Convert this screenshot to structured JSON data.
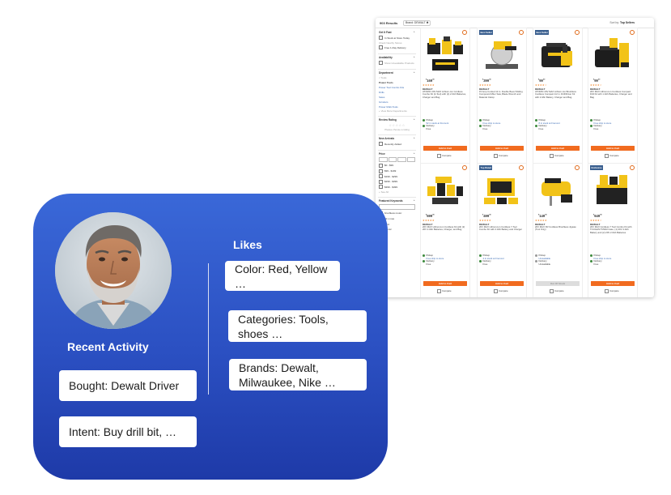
{
  "shop": {
    "results_count": "903 Results",
    "filter_chip": "Brand: DEWALT ✖",
    "sort_label": "Sort by:",
    "sort_value": "Top Sellers",
    "sidebar": {
      "get_it_fast": "Get It Fast",
      "in_stock": "In Stock at Store Today",
      "pickup_note": "Check Nearby Stores",
      "free_delivery": "Free 1-Day Delivery",
      "availability": "Availability",
      "include_out": "Show Unavailable Products",
      "department": "Department",
      "tools": "< Tools",
      "power_tools": "Power Tools",
      "power_tool_combo": "Power Tool Combo Kits",
      "drills": "Drills",
      "saws": "Saws",
      "grinders": "Grinders",
      "power_multi": "Power Multi-Tools",
      "view_more": "+ View More Departments",
      "review_rating": "Review Rating",
      "stars": "☆☆☆☆☆",
      "choose_rating": "Please choose a rating",
      "new_arrivals": "New Arrivals",
      "recently_added": "Recently Added",
      "price": "Price",
      "price_ranges": [
        "$0 - $99",
        "$99 - $199",
        "$199 - $299",
        "$299 - $399",
        "$399 - $499"
      ],
      "see_all": "+ See All",
      "featured_keywords": "Featured Keywords",
      "keywords": [
        "brushless motor",
        "20 v max",
        "cord",
        "atomic"
      ]
    },
    "cards": [
      {
        "badge": "",
        "price": "169",
        "cents": "00",
        "stars": "★★★★★",
        "brand": "DEWALT",
        "desc": "ATOMIC 20V MAX Lithium-Ion Cordless Combo Kit (4-Tool) with (2) 2.0Ah Batteries, Charger and Bag",
        "pickup": "Pickup",
        "pickup_sub": "52 in stock at Fremont",
        "delivery": "Delivery",
        "delivery_sub": "Free",
        "cart": "Add to Cart",
        "compare": "Compare"
      },
      {
        "badge": "Best Seller",
        "price": "399",
        "cents": "00",
        "stars": "★★★★★",
        "brand": "DEWALT",
        "desc": "15 Amp Corded 12 in. Double Bevel Sliding Compound Miter Saw, Blade Wrench and Material Clamp",
        "pickup": "Pickup",
        "pickup_sub": "Free ship to store",
        "delivery": "Delivery",
        "delivery_sub": "Free",
        "cart": "Add to Cart",
        "compare": "Compare"
      },
      {
        "badge": "Best Seller",
        "price": "99",
        "cents": "00",
        "stars": "★★★★☆",
        "brand": "DEWALT",
        "desc": "ATOMIC 20V MAX Lithium-Ion Brushless Cordless Compact 1/2 in. Drill/Driver Kit with 2.0Ah Battery, Charger and Bag",
        "pickup": "Pickup",
        "pickup_sub": "8 in stock at Fremont",
        "delivery": "Delivery",
        "delivery_sub": "Free",
        "cart": "Add to Cart",
        "compare": "Compare"
      },
      {
        "badge": "",
        "price": "99",
        "cents": "00",
        "stars": "★★★★☆",
        "brand": "DEWALT",
        "desc": "20V MAX Lithium-Ion Cordless Compact Drill Kit with 1.3Ah Batteries, Charger and Bag",
        "pickup": "Pickup",
        "pickup_sub": "Free ship to store",
        "delivery": "Delivery",
        "delivery_sub": "Free",
        "cart": "Add to Cart",
        "compare": "Compare"
      },
      {
        "badge": "",
        "price": "599",
        "cents": "00",
        "stars": "★★★★★",
        "brand": "DEWALT",
        "desc": "20V MAX Lithium-Ion Cordless Kit with (2) 20V 2.0Ah Batteries, Charger, and Bag",
        "pickup": "Pickup",
        "pickup_sub": "Free ship to store",
        "delivery": "Delivery",
        "delivery_sub": "Free",
        "cart": "Add to Cart",
        "compare": "Compare"
      },
      {
        "badge": "Top Rated",
        "price": "499",
        "cents": "00",
        "stars": "★★★★★",
        "brand": "DEWALT",
        "desc": "20V MAX Lithium-Ion Cordless 7-Tool Combo Kit with 2.0Ah Battery and Charger",
        "pickup": "Pickup",
        "pickup_sub": "4 in stock at Fremont",
        "delivery": "Delivery",
        "delivery_sub": "Free",
        "cart": "Add to Cart",
        "compare": "Compare"
      },
      {
        "badge": "",
        "price": "149",
        "cents": "00",
        "stars": "★★★★★",
        "brand": "DEWALT",
        "desc": "20V MAX XR Cordless Brushless Jigsaw (Tool Only)",
        "pickup": "Pickup",
        "pickup_sub": "Unavailable",
        "delivery": "Delivery",
        "delivery_sub": "Unavailable",
        "cart": "Out Of Stock",
        "compare": "Compare"
      },
      {
        "badge": "Exclusive",
        "price": "649",
        "cents": "00",
        "stars": "★★★★☆",
        "brand": "DEWALT",
        "desc": "20V MAX Cordless 7 Tool Combo Kit with TOUGHSYSTEM Case, (1) 20V 4.0Ah Battery and (2) 20V 2.0Ah Batteries",
        "pickup": "Pickup",
        "pickup_sub": "Free ship to store",
        "delivery": "Delivery",
        "delivery_sub": "Free",
        "cart": "Add to Cart",
        "compare": "Compare"
      }
    ]
  },
  "activity": {
    "likes_title": "Likes",
    "recent_title": "Recent Activity",
    "likes": [
      "Color: Red, Yellow …",
      "Categories: Tools, shoes …",
      "Brands: Dewalt, Milwaukee, Nike …"
    ],
    "recent": [
      "Bought: Dewalt Driver",
      "Intent: Buy drill bit, …"
    ]
  },
  "colors": {
    "card_gradient_top": "#3a68d8",
    "card_gradient_bottom": "#1e3aa8",
    "cta_orange": "#f16b1f",
    "dewalt_yellow": "#f2c318"
  }
}
